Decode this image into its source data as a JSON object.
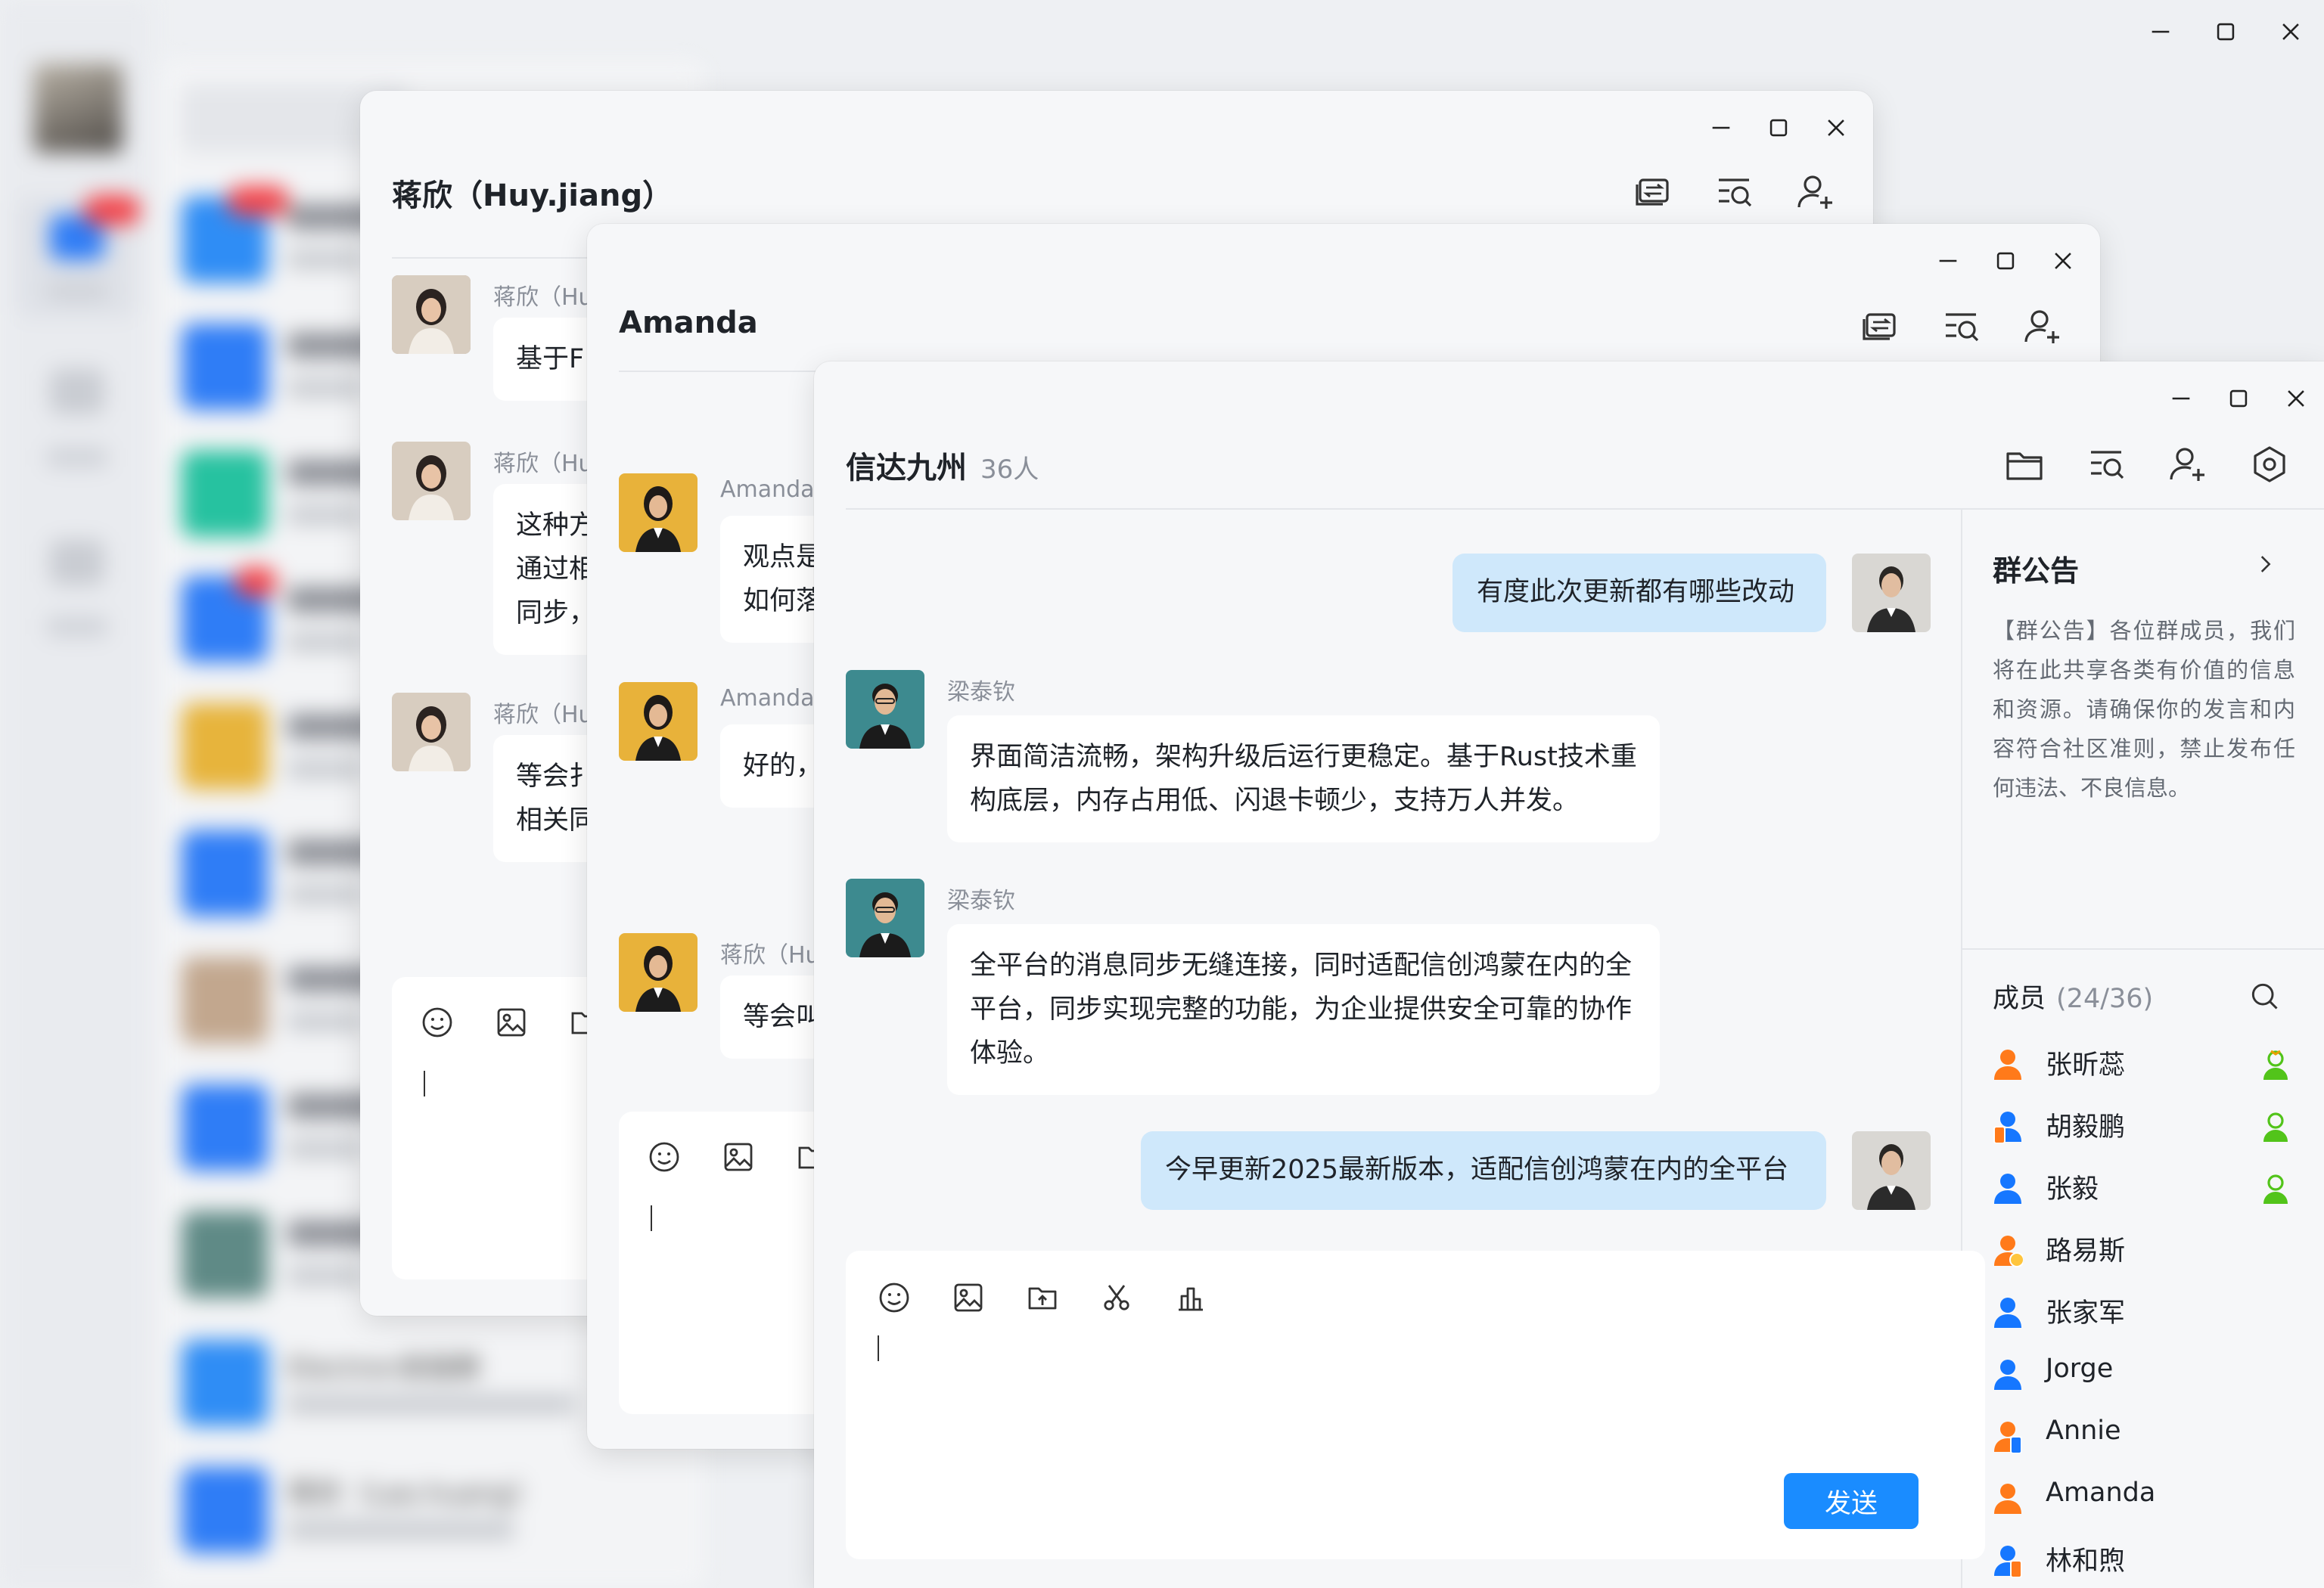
{
  "app": {
    "window_controls": {
      "minimize": "minimize-icon",
      "maximize": "maximize-icon",
      "close": "close-icon"
    },
    "background_list": {
      "visible_items": [
        "Electron发版群"
      ],
      "blurred_contact": "蒋欣（Lao.huang）"
    }
  },
  "windows": {
    "jiang": {
      "title": "蒋欣（Huy.jiang）",
      "messages": [
        {
          "sender": "蒋欣（Hu",
          "text": "基于F"
        },
        {
          "sender": "蒋欣（Hu",
          "lines": [
            "这种方",
            "通过相",
            "同步，"
          ]
        },
        {
          "sender": "蒋欣（Hu",
          "lines": [
            "等会扌",
            "相关同"
          ]
        }
      ]
    },
    "amanda": {
      "title": "Amanda",
      "messages": [
        {
          "sender": "Amanda",
          "lines": [
            "观点是",
            "如何落"
          ]
        },
        {
          "sender": "Amanda",
          "text": "好的，"
        },
        {
          "sender": "蒋欣（Hu",
          "text": "等会叫"
        }
      ]
    },
    "group": {
      "title": "信达九州",
      "member_count": "36人",
      "messages": [
        {
          "mine": true,
          "text": "有度此次更新都有哪些改动"
        },
        {
          "sender": "梁泰钦",
          "lines": [
            "界面简洁流畅，架构升级后运行更稳定。基于Rust技术重",
            "构底层，内存占用低、闪退卡顿少，支持万人并发。"
          ]
        },
        {
          "sender": "梁泰钦",
          "lines": [
            "全平台的消息同步无缝连接，同时适配信创鸿蒙在内的全",
            "平台，同步实现完整的功能，为企业提供安全可靠的协作",
            "体验。"
          ]
        },
        {
          "mine": true,
          "text": "今早更新2025最新版本，适配信创鸿蒙在内的全平台"
        }
      ],
      "send_label": "发送",
      "announcement": {
        "title": "群公告",
        "text": "【群公告】各位群成员，我们将在此共享各类有价值的信息和资源。请确保你的发言和内容符合社区准则，禁止发布任何违法、不良信息。"
      },
      "members": {
        "title": "成员",
        "count": "(24/36)",
        "list": [
          {
            "name": "张昕蕊",
            "icon": "person-orange-icon",
            "role": "admin-icon"
          },
          {
            "name": "胡毅鹏",
            "icon": "person-blue-mobile-icon",
            "role": "admin-icon"
          },
          {
            "name": "张毅",
            "icon": "person-blue-icon",
            "role": "admin-icon"
          },
          {
            "name": "路易斯",
            "icon": "person-orange-away-icon"
          },
          {
            "name": "张家军",
            "icon": "person-blue-icon"
          },
          {
            "name": "Jorge",
            "icon": "person-blue-icon"
          },
          {
            "name": "Annie",
            "icon": "person-orange-mobile-icon"
          },
          {
            "name": "Amanda",
            "icon": "person-orange-icon"
          },
          {
            "name": "林和煦",
            "icon": "person-blue-mobile-icon"
          }
        ]
      }
    }
  },
  "colors": {
    "accent": "#1a8cff",
    "my_bubble": "#cfe8fb",
    "member_blue": "#1677ff",
    "member_orange": "#ff7a1a",
    "admin_green": "#52c41a"
  }
}
